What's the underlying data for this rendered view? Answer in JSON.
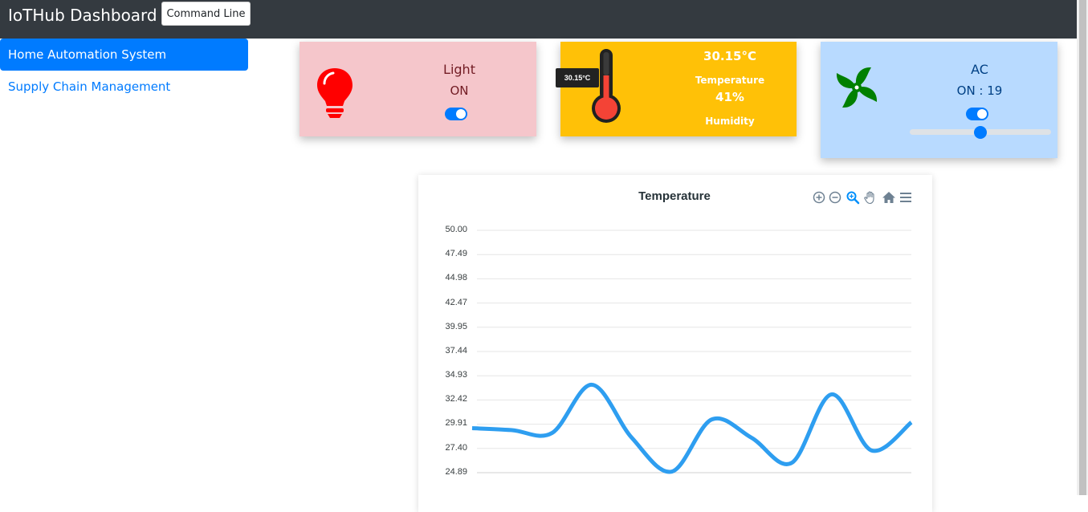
{
  "navbar": {
    "brand": "IoTHub Dashboard",
    "command_line_label": "Command Line"
  },
  "sidebar": {
    "items": [
      {
        "label": "Home Automation System",
        "active": true
      },
      {
        "label": "Supply Chain Management",
        "active": false
      }
    ]
  },
  "cards": {
    "light": {
      "title": "Light",
      "status": "ON",
      "icon": "lightbulb-icon",
      "toggle_on": true,
      "color": "#f5c6cb"
    },
    "climate": {
      "thermometer_tooltip": "30.15°C",
      "temperature_value": "30.15°C",
      "temperature_label": "Temperature",
      "humidity_value": "41%",
      "humidity_label": "Humidity",
      "icon": "thermometer-icon",
      "color": "#ffc107"
    },
    "ac": {
      "title": "AC",
      "status": "ON : 19",
      "icon": "fan-icon",
      "toggle_on": true,
      "slider_level": 0.5,
      "color": "#b8daff"
    }
  },
  "chart": {
    "toolbar": [
      "zoom-in-icon",
      "zoom-out-icon",
      "selection-zoom-icon",
      "pan-icon",
      "reset-zoom-icon",
      "menu-icon"
    ],
    "line_color": "#2e9ef0"
  },
  "chart_data": {
    "type": "line",
    "title": "Temperature",
    "y_ticks": [
      "50.00",
      "47.49",
      "44.98",
      "42.47",
      "39.95",
      "37.44",
      "34.93",
      "32.42",
      "29.91",
      "27.40",
      "24.89"
    ],
    "ylim": [
      24.89,
      50.0
    ],
    "grid": true,
    "series": [
      {
        "values": [
          29.5,
          29.3,
          29.0,
          34.0,
          28.5,
          25.0,
          30.4,
          28.5,
          25.9,
          33.0,
          27.2,
          30.1
        ]
      }
    ]
  }
}
